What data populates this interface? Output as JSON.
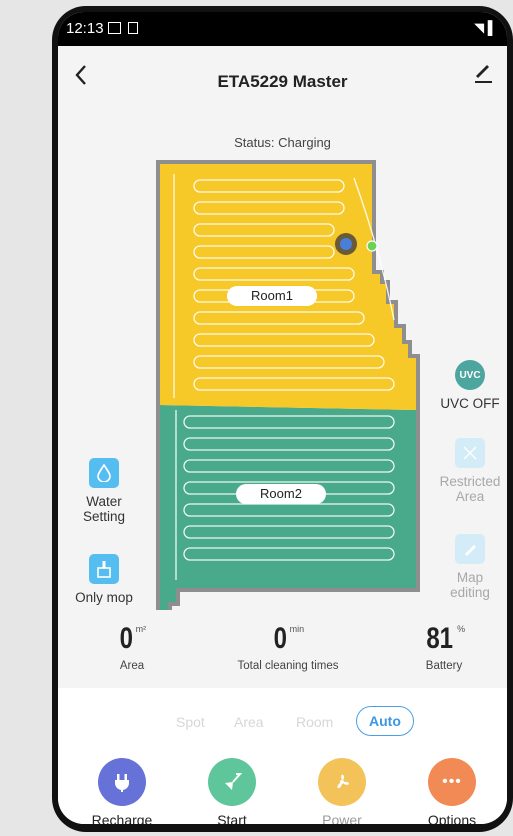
{
  "statusbar": {
    "time": "12:13",
    "signal": "◥ ▌"
  },
  "header": {
    "title": "ETA5229 Master",
    "back_icon": "chevron-left-icon",
    "edit_icon": "pencil-icon"
  },
  "status_text": "Status: Charging",
  "map": {
    "room1": "Room1",
    "room2": "Room2",
    "room1_color": "#f6c929",
    "room2_color": "#48a98b",
    "wall_color": "#8e8e8e"
  },
  "left_controls": {
    "water_setting": "Water Setting",
    "only_mop": "Only mop"
  },
  "right_controls": {
    "uvc_icon_text": "UVC",
    "uvc": "UVC OFF",
    "restricted": "Restricted Area",
    "map_editing": "Map editing"
  },
  "stats": {
    "area": {
      "value": "0",
      "unit": "m²",
      "label": "Area"
    },
    "cleaning": {
      "value": "0",
      "unit": "min",
      "label": "Total cleaning times"
    },
    "battery": {
      "value": "81",
      "unit": "%",
      "label": "Battery"
    }
  },
  "modes": {
    "spot": "Spot",
    "area": "Area",
    "room": "Room",
    "auto": "Auto",
    "selected": "Auto"
  },
  "actions": {
    "recharge": "Recharge",
    "start": "Start",
    "power": "Power",
    "options": "Options"
  },
  "colors": {
    "accent": "#3b97e6",
    "recharge": "#6672d8",
    "start": "#5ec69a",
    "power": "#f3c35a",
    "options": "#f28a56"
  }
}
